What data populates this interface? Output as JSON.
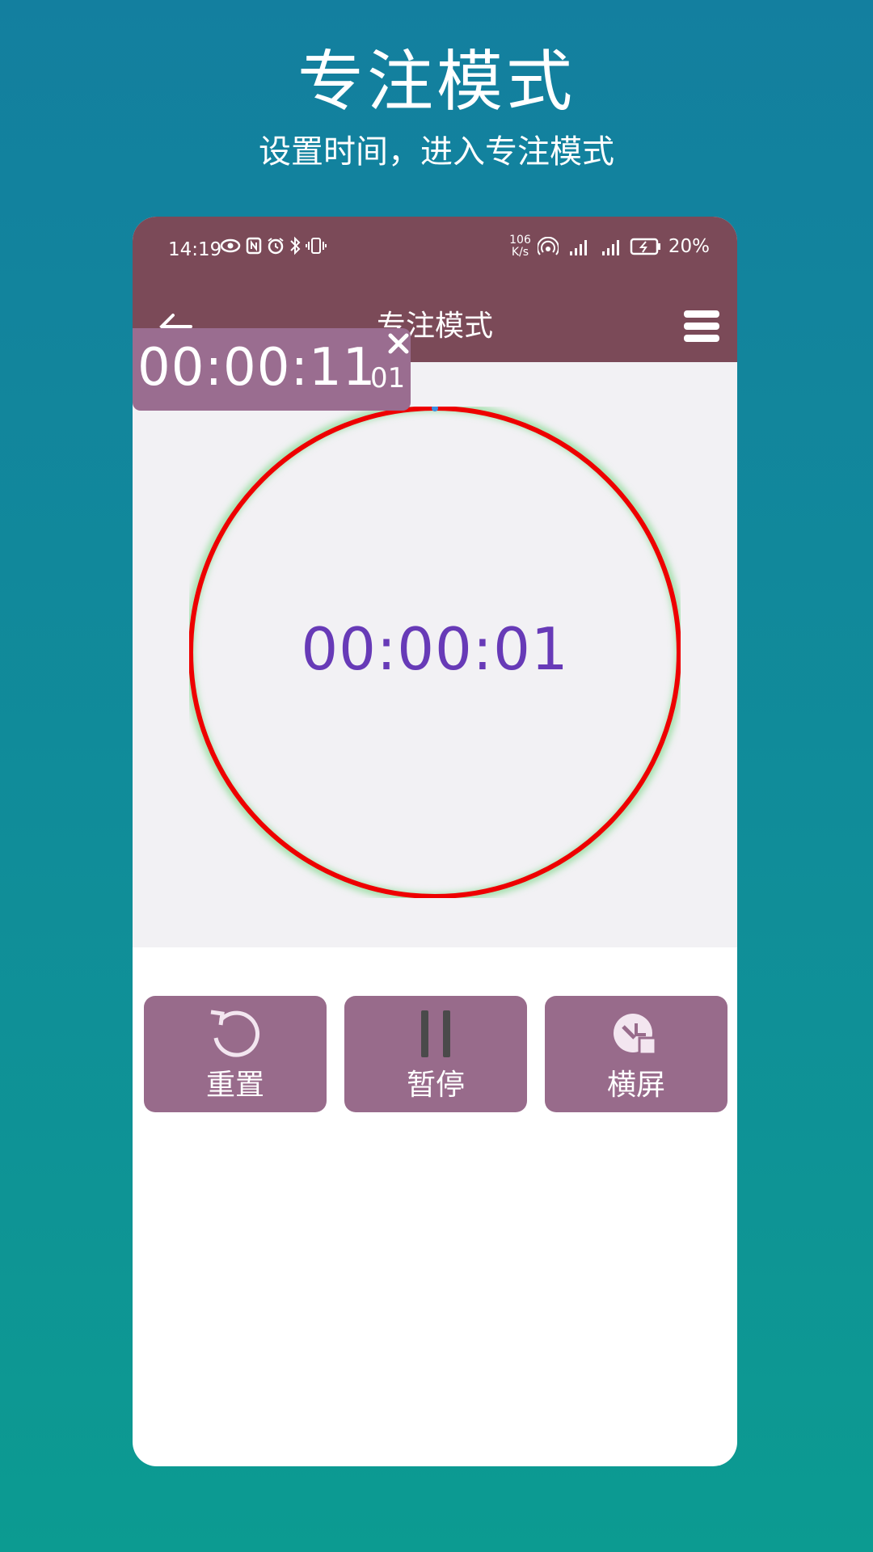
{
  "promo": {
    "title": "专注模式",
    "subtitle": "设置时间，进入专注模式"
  },
  "status_bar": {
    "time": "14:19",
    "net_speed_value": "106",
    "net_speed_unit": "K/s",
    "battery": "20%"
  },
  "app_bar": {
    "title": "专注模式",
    "back_icon": "arrow-left-icon",
    "menu_icon": "menu-icon"
  },
  "floating_timer": {
    "time": "00:00:11",
    "count": "01"
  },
  "timer": {
    "display": "00:00:01",
    "ring_color": "#ee0000",
    "text_color": "#673ab7"
  },
  "actions": [
    {
      "label": "重置",
      "icon": "reset-icon"
    },
    {
      "label": "暂停",
      "icon": "pause-icon"
    },
    {
      "label": "横屏",
      "icon": "landscape-icon"
    }
  ],
  "colors": {
    "accent": "#7b4a58",
    "button": "#986b8b",
    "bg_top": "#137f9f",
    "bg_bottom": "#0c9b91"
  }
}
